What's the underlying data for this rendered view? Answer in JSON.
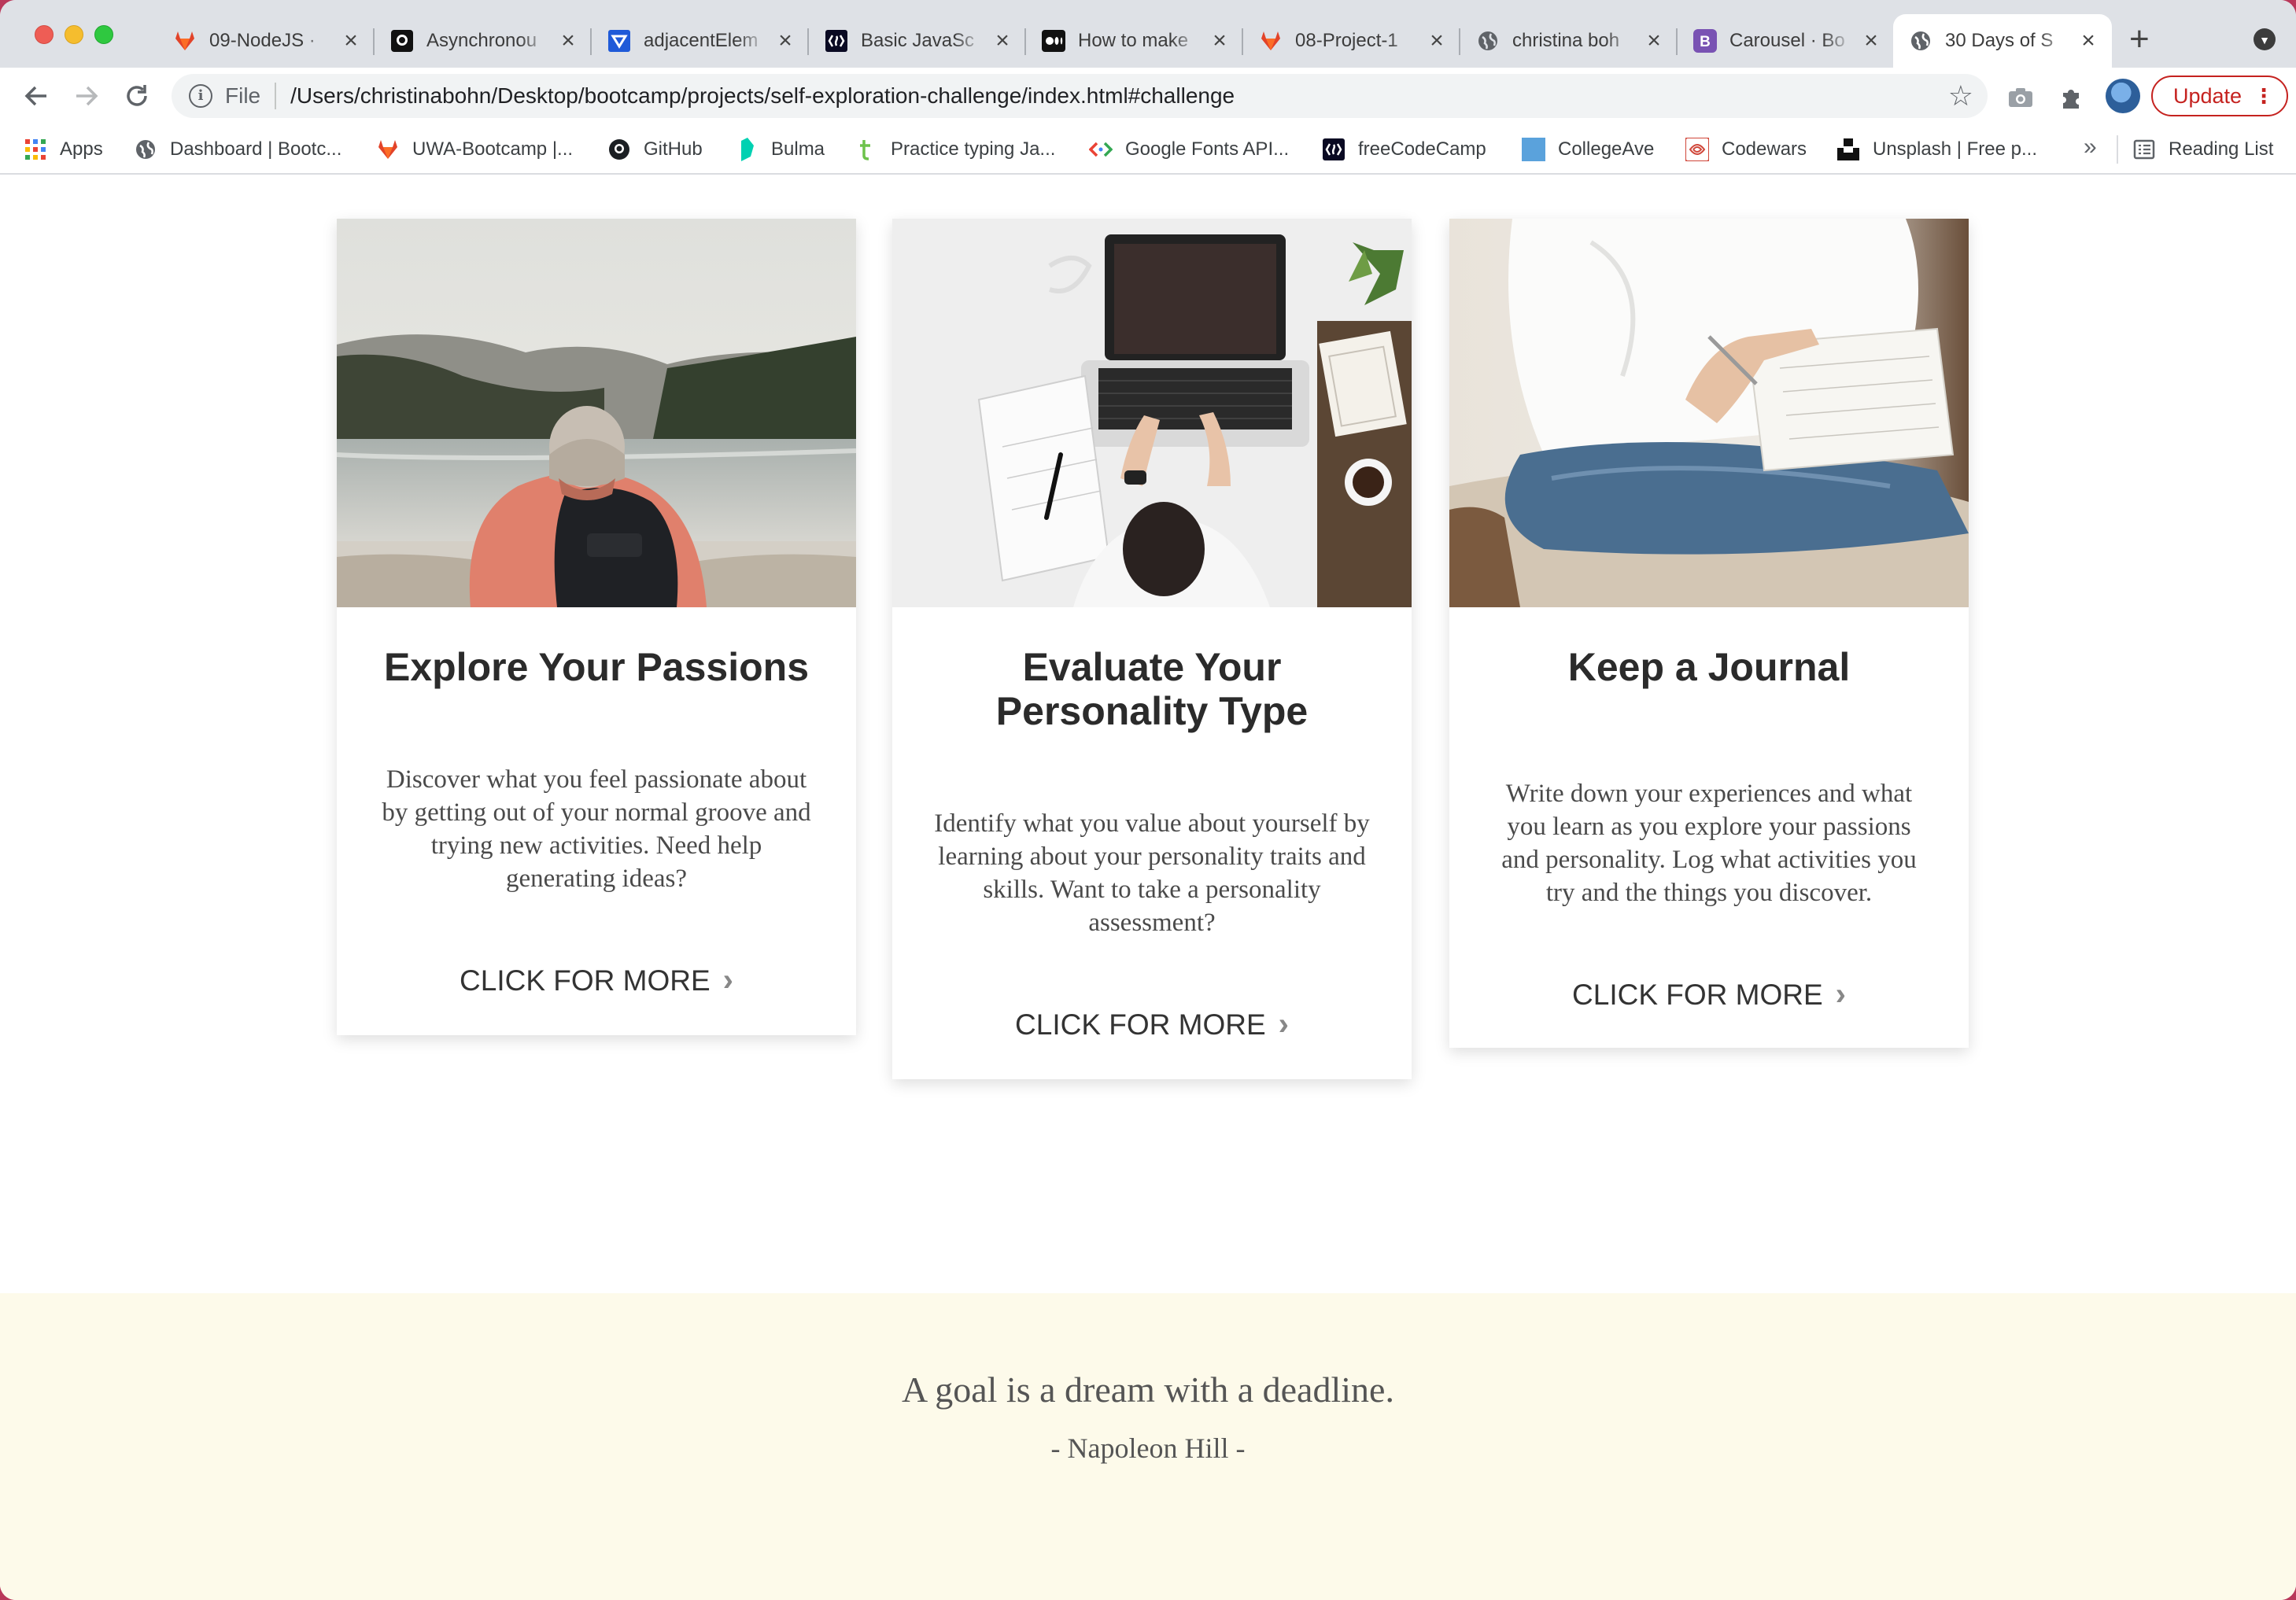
{
  "browser": {
    "tabs": [
      {
        "title": "09-NodeJS · ",
        "favicon": "gitlab-icon"
      },
      {
        "title": "Asynchronou",
        "favicon": "github-icon"
      },
      {
        "title": "adjacentElem",
        "favicon": "w3-icon"
      },
      {
        "title": "Basic JavaSc",
        "favicon": "freecodecamp-icon"
      },
      {
        "title": "How to make",
        "favicon": "medium-icon"
      },
      {
        "title": "08-Project-1",
        "favicon": "gitlab-icon"
      },
      {
        "title": "christina boh",
        "favicon": "globe-icon"
      },
      {
        "title": "Carousel · Bo",
        "favicon": "bootstrap-icon"
      },
      {
        "title": "30 Days of S",
        "favicon": "globe-icon",
        "active": true
      }
    ],
    "address": {
      "scheme": "File",
      "url": "/Users/christinabohn/Desktop/bootcamp/projects/self-exploration-challenge/index.html#challenge"
    },
    "update_label": "Update",
    "bookmarks": [
      {
        "label": "Apps",
        "icon": "apps-grid-icon"
      },
      {
        "label": "Dashboard | Bootc...",
        "icon": "globe-icon"
      },
      {
        "label": "UWA-Bootcamp |...",
        "icon": "gitlab-icon"
      },
      {
        "label": "GitHub",
        "icon": "github-icon"
      },
      {
        "label": "Bulma",
        "icon": "bulma-icon"
      },
      {
        "label": "Practice typing Ja...",
        "icon": "typing-icon"
      },
      {
        "label": "Google Fonts API...",
        "icon": "code-icon"
      },
      {
        "label": "freeCodeCamp",
        "icon": "freecodecamp-icon"
      },
      {
        "label": "CollegeAve",
        "icon": "square-icon"
      },
      {
        "label": "Codewars",
        "icon": "codewars-icon"
      },
      {
        "label": "Unsplash | Free p...",
        "icon": "unsplash-icon"
      }
    ],
    "more_bookmarks": "»",
    "reading_list": "Reading List"
  },
  "cards": [
    {
      "title": "Explore Your Passions",
      "text": "Discover what you feel passionate about by getting out of your normal groove and trying new activities. Need help generating ideas?",
      "cta": "CLICK FOR MORE"
    },
    {
      "title": "Evaluate Your Personality Type",
      "text": "Identify what you value about yourself by learning about your personality traits and skills. Want to take a personality assessment?",
      "cta": "CLICK FOR MORE"
    },
    {
      "title": "Keep a Journal",
      "text": "Write down your experiences and what you learn as you explore your passions and personality. Log what activities you try and the things you discover.",
      "cta": "CLICK FOR MORE"
    }
  ],
  "quote": {
    "text": "A goal is a dream with a deadline.",
    "author": "- Napoleon Hill -"
  },
  "colors": {
    "quote_band": "#fdfaea",
    "update_red": "#c5221f"
  }
}
